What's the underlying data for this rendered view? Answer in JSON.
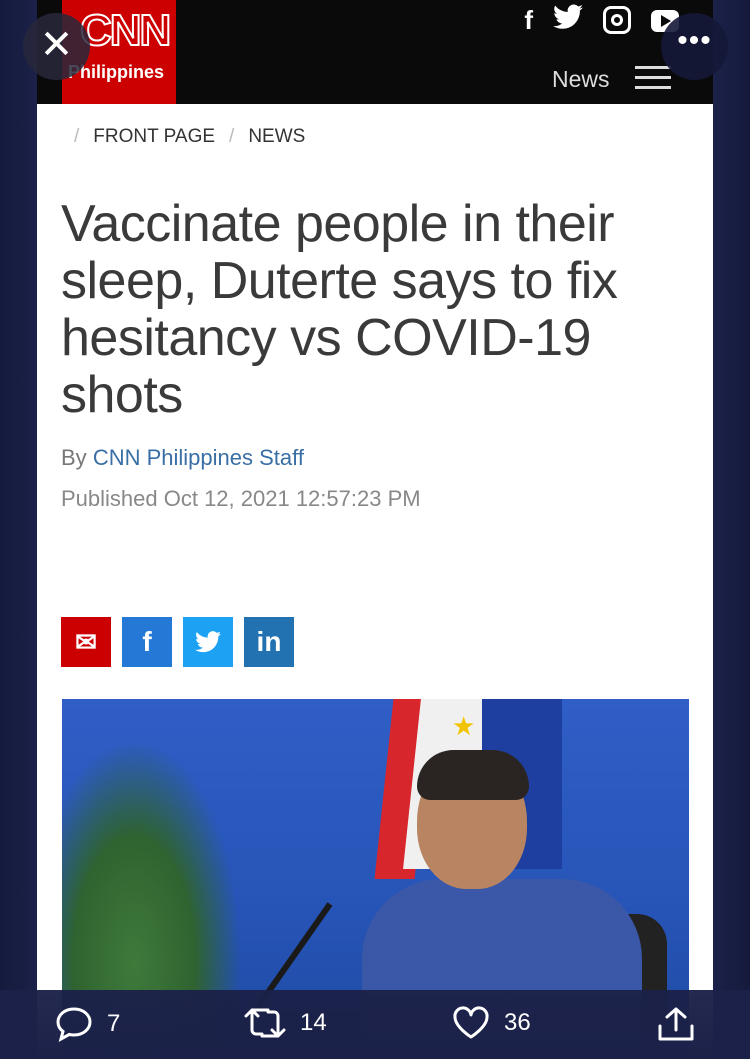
{
  "site": {
    "logo_main": "CNN",
    "logo_sub": "Philippines",
    "nav_label": "News",
    "social_icons": [
      "facebook-icon",
      "twitter-icon",
      "instagram-icon",
      "youtube-icon"
    ]
  },
  "overlay": {
    "close_glyph": "✕",
    "more_glyph": "•••"
  },
  "breadcrumb": {
    "items": [
      "FRONT PAGE",
      "NEWS"
    ],
    "separator": "/"
  },
  "article": {
    "headline": "Vaccinate people in their sleep, Duterte says to fix hesitancy vs COVID-19 shots",
    "byline_prefix": "By",
    "author": "CNN Philippines Staff",
    "published": "Published Oct 12, 2021 12:57:23 PM"
  },
  "share_buttons": {
    "email": "✉",
    "facebook": "f",
    "twitter": "t",
    "linkedin": "in"
  },
  "tweet_actions": {
    "replies": "7",
    "retweets": "14",
    "likes": "36"
  },
  "colors": {
    "brand_red": "#cc0000",
    "link_blue": "#3a6fa6",
    "app_bg": "#1b2148"
  }
}
